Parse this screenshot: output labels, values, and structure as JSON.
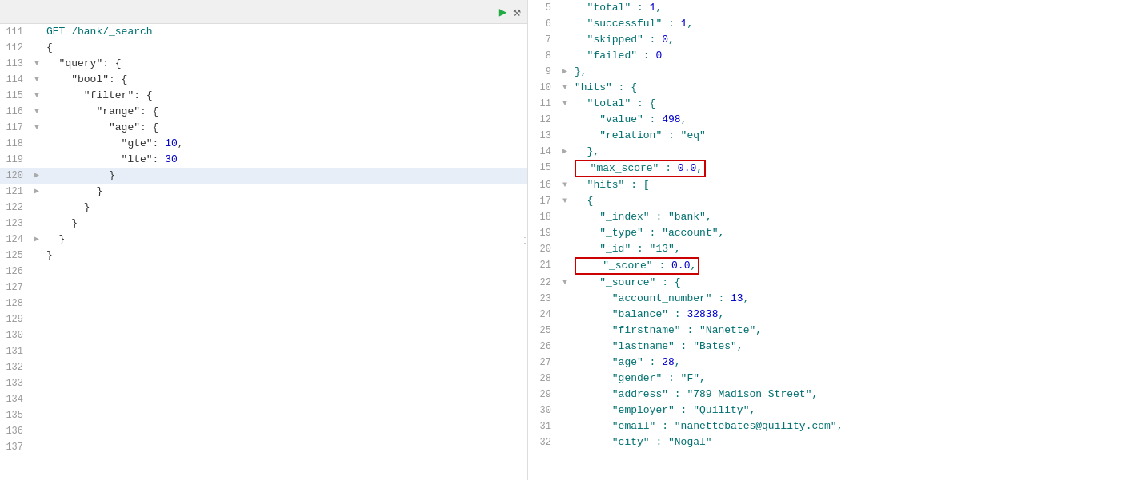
{
  "left": {
    "toolbar": {
      "title": "GET /bank/_search",
      "play_label": "▶",
      "tool_label": "🔧"
    },
    "lines": [
      {
        "num": 111,
        "fold": "",
        "content": "GET /bank/_search",
        "highlight": false,
        "indent": 0
      },
      {
        "num": 112,
        "fold": "",
        "content": "{",
        "highlight": false,
        "indent": 0
      },
      {
        "num": 113,
        "fold": "▼",
        "content": "  \"query\": {",
        "highlight": false,
        "indent": 0
      },
      {
        "num": 114,
        "fold": "▼",
        "content": "    \"bool\": {",
        "highlight": false,
        "indent": 0
      },
      {
        "num": 115,
        "fold": "▼",
        "content": "      \"filter\": {",
        "highlight": false,
        "indent": 0
      },
      {
        "num": 116,
        "fold": "▼",
        "content": "        \"range\": {",
        "highlight": false,
        "indent": 0
      },
      {
        "num": 117,
        "fold": "▼",
        "content": "          \"age\": {",
        "highlight": false,
        "indent": 0
      },
      {
        "num": 118,
        "fold": "",
        "content": "            \"gte\": 10,",
        "highlight": false,
        "indent": 0
      },
      {
        "num": 119,
        "fold": "",
        "content": "            \"lte\": 30",
        "highlight": false,
        "indent": 0
      },
      {
        "num": 120,
        "fold": "▶",
        "content": "          }",
        "highlight": true,
        "indent": 0
      },
      {
        "num": 121,
        "fold": "▶",
        "content": "        }",
        "highlight": false,
        "indent": 0
      },
      {
        "num": 122,
        "fold": "",
        "content": "      }",
        "highlight": false,
        "indent": 0
      },
      {
        "num": 123,
        "fold": "",
        "content": "    }",
        "highlight": false,
        "indent": 0
      },
      {
        "num": 124,
        "fold": "▶",
        "content": "  }",
        "highlight": false,
        "indent": 0
      },
      {
        "num": 125,
        "fold": "",
        "content": "}",
        "highlight": false,
        "indent": 0
      },
      {
        "num": 126,
        "fold": "",
        "content": "",
        "highlight": false,
        "indent": 0
      },
      {
        "num": 127,
        "fold": "",
        "content": "",
        "highlight": false,
        "indent": 0
      },
      {
        "num": 128,
        "fold": "",
        "content": "",
        "highlight": false,
        "indent": 0
      },
      {
        "num": 129,
        "fold": "",
        "content": "",
        "highlight": false,
        "indent": 0
      },
      {
        "num": 130,
        "fold": "",
        "content": "",
        "highlight": false,
        "indent": 0
      },
      {
        "num": 131,
        "fold": "",
        "content": "",
        "highlight": false,
        "indent": 0
      },
      {
        "num": 132,
        "fold": "",
        "content": "",
        "highlight": false,
        "indent": 0
      },
      {
        "num": 133,
        "fold": "",
        "content": "",
        "highlight": false,
        "indent": 0
      },
      {
        "num": 134,
        "fold": "",
        "content": "",
        "highlight": false,
        "indent": 0
      },
      {
        "num": 135,
        "fold": "",
        "content": "",
        "highlight": false,
        "indent": 0
      },
      {
        "num": 136,
        "fold": "",
        "content": "",
        "highlight": false,
        "indent": 0
      },
      {
        "num": 137,
        "fold": "",
        "content": "",
        "highlight": false,
        "indent": 0
      }
    ]
  },
  "right": {
    "lines": [
      {
        "num": 5,
        "fold": "",
        "highlighted_box": false,
        "content_parts": [
          {
            "text": "  \"total\" : 1,",
            "color": "teal"
          }
        ]
      },
      {
        "num": 6,
        "fold": "",
        "highlighted_box": false,
        "content_parts": [
          {
            "text": "  \"successful\" : 1,",
            "color": "teal"
          }
        ]
      },
      {
        "num": 7,
        "fold": "",
        "highlighted_box": false,
        "content_parts": [
          {
            "text": "  \"skipped\" : 0,",
            "color": "teal"
          }
        ]
      },
      {
        "num": 8,
        "fold": "",
        "highlighted_box": false,
        "content_parts": [
          {
            "text": "  \"failed\" : 0",
            "color": "teal"
          }
        ]
      },
      {
        "num": 9,
        "fold": "▶",
        "highlighted_box": false,
        "content_parts": [
          {
            "text": "},",
            "color": "normal"
          }
        ]
      },
      {
        "num": 10,
        "fold": "▼",
        "highlighted_box": false,
        "content_parts": [
          {
            "text": "\"hits\" : {",
            "color": "teal"
          }
        ]
      },
      {
        "num": 11,
        "fold": "▼",
        "highlighted_box": false,
        "content_parts": [
          {
            "text": "  \"total\" : {",
            "color": "teal"
          }
        ]
      },
      {
        "num": 12,
        "fold": "",
        "highlighted_box": false,
        "content_parts": [
          {
            "text": "    \"value\" : 498,",
            "color": "teal"
          }
        ]
      },
      {
        "num": 13,
        "fold": "",
        "highlighted_box": false,
        "content_parts": [
          {
            "text": "    \"relation\" : \"eq\"",
            "color": "teal"
          }
        ]
      },
      {
        "num": 14,
        "fold": "▶",
        "highlighted_box": false,
        "content_parts": [
          {
            "text": "  },",
            "color": "normal"
          }
        ]
      },
      {
        "num": 15,
        "fold": "",
        "highlighted_box": true,
        "content_parts": [
          {
            "text": "  \"max_score\" : 0.0,",
            "color": "teal"
          }
        ]
      },
      {
        "num": 16,
        "fold": "▼",
        "highlighted_box": false,
        "content_parts": [
          {
            "text": "  \"hits\" : [",
            "color": "teal"
          }
        ]
      },
      {
        "num": 17,
        "fold": "▼",
        "highlighted_box": false,
        "content_parts": [
          {
            "text": "  {",
            "color": "normal"
          }
        ]
      },
      {
        "num": 18,
        "fold": "",
        "highlighted_box": false,
        "content_parts": [
          {
            "text": "    \"_index\" : \"bank\",",
            "color": "teal"
          }
        ]
      },
      {
        "num": 19,
        "fold": "",
        "highlighted_box": false,
        "content_parts": [
          {
            "text": "    \"_type\" : \"account\",",
            "color": "teal"
          }
        ]
      },
      {
        "num": 20,
        "fold": "",
        "highlighted_box": false,
        "content_parts": [
          {
            "text": "    \"_id\" : \"13\",",
            "color": "teal"
          }
        ]
      },
      {
        "num": 21,
        "fold": "",
        "highlighted_box": true,
        "content_parts": [
          {
            "text": "    \"_score\" : 0.0,",
            "color": "teal"
          }
        ]
      },
      {
        "num": 22,
        "fold": "▼",
        "highlighted_box": false,
        "content_parts": [
          {
            "text": "    \"_source\" : {",
            "color": "teal"
          }
        ]
      },
      {
        "num": 23,
        "fold": "",
        "highlighted_box": false,
        "content_parts": [
          {
            "text": "      \"account_number\" : 13,",
            "color": "teal"
          }
        ]
      },
      {
        "num": 24,
        "fold": "",
        "highlighted_box": false,
        "content_parts": [
          {
            "text": "      \"balance\" : 32838,",
            "color": "teal"
          }
        ]
      },
      {
        "num": 25,
        "fold": "",
        "highlighted_box": false,
        "content_parts": [
          {
            "text": "      \"firstname\" : \"Nanette\",",
            "color": "teal"
          }
        ]
      },
      {
        "num": 26,
        "fold": "",
        "highlighted_box": false,
        "content_parts": [
          {
            "text": "      \"lastname\" : \"Bates\",",
            "color": "teal"
          }
        ]
      },
      {
        "num": 27,
        "fold": "",
        "highlighted_box": false,
        "content_parts": [
          {
            "text": "      \"age\" : 28,",
            "color": "teal"
          }
        ]
      },
      {
        "num": 28,
        "fold": "",
        "highlighted_box": false,
        "content_parts": [
          {
            "text": "      \"gender\" : \"F\",",
            "color": "teal"
          }
        ]
      },
      {
        "num": 29,
        "fold": "",
        "highlighted_box": false,
        "content_parts": [
          {
            "text": "      \"address\" : \"789 Madison Street\",",
            "color": "teal"
          }
        ]
      },
      {
        "num": 30,
        "fold": "",
        "highlighted_box": false,
        "content_parts": [
          {
            "text": "      \"employer\" : \"Quility\",",
            "color": "teal"
          }
        ]
      },
      {
        "num": 31,
        "fold": "",
        "highlighted_box": false,
        "content_parts": [
          {
            "text": "      \"email\" : \"nanettebates@quility.com\",",
            "color": "teal"
          }
        ]
      },
      {
        "num": 32,
        "fold": "",
        "highlighted_box": false,
        "content_parts": [
          {
            "text": "      \"city\" : \"Nogal\"",
            "color": "teal"
          }
        ]
      }
    ]
  },
  "colors": {
    "teal": "#007070",
    "red_key": "#990000",
    "blue_val": "#0000cc",
    "highlight_bg": "#e8eef8",
    "border_red": "#cc0000",
    "line_num": "#999999",
    "normal": "#333333"
  }
}
